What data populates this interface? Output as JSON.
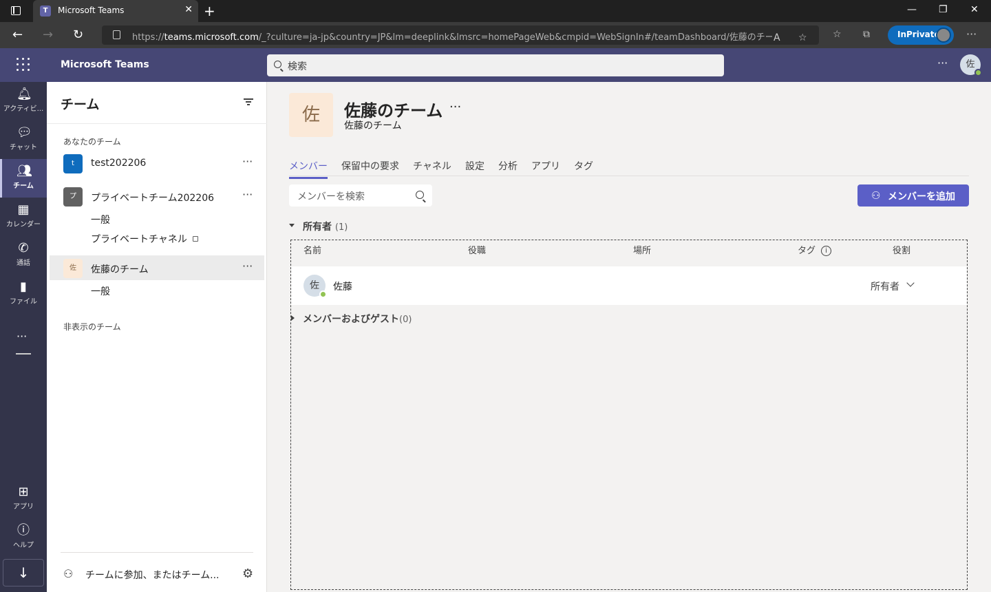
{
  "browser": {
    "tab_title": "Microsoft Teams",
    "url_prefix": "https://",
    "url_host": "teams.microsoft.com",
    "url_rest": "/_?culture=ja-jp&country=JP&lm=deeplink&lmsrc=homePageWeb&cmpid=WebSignIn#/teamDashboard/佐藤のチーム/...",
    "inprivate_label": "InPrivate"
  },
  "header": {
    "brand": "Microsoft Teams",
    "search_placeholder": "検索",
    "user_initial": "佐"
  },
  "rail": {
    "items": [
      {
        "label": "アクティビ...",
        "icon": "bell-icon"
      },
      {
        "label": "チャット",
        "icon": "chat-icon"
      },
      {
        "label": "チーム",
        "icon": "teams-icon"
      },
      {
        "label": "カレンダー",
        "icon": "calendar-icon"
      },
      {
        "label": "通話",
        "icon": "phone-icon"
      },
      {
        "label": "ファイル",
        "icon": "file-icon"
      }
    ],
    "apps_label": "アプリ",
    "help_label": "ヘルプ"
  },
  "panel": {
    "title": "チーム",
    "your_teams_label": "あなたのチーム",
    "teams": [
      {
        "badge": "t",
        "name": "test202206"
      },
      {
        "badge": "プ",
        "name": "プライベートチーム202206",
        "channels": [
          "一般",
          "プライベートチャネル"
        ]
      },
      {
        "badge": "佐",
        "name": "佐藤のチーム",
        "channels": [
          "一般"
        ]
      }
    ],
    "hidden_teams_label": "非表示のチーム",
    "join_label": "チームに参加、またはチーム..."
  },
  "main": {
    "avatar": "佐",
    "title": "佐藤のチーム",
    "subtitle": "佐藤のチーム",
    "tabs": [
      "メンバー",
      "保留中の要求",
      "チャネル",
      "設定",
      "分析",
      "アプリ",
      "タグ"
    ],
    "member_search_placeholder": "メンバーを検索",
    "add_member_label": "メンバーを追加",
    "owners_group": {
      "title": "所有者",
      "count": "(1)"
    },
    "columns": [
      "名前",
      "役職",
      "場所",
      "タグ",
      "役割"
    ],
    "members": [
      {
        "initial": "佐",
        "name": "佐藤",
        "role": "所有者"
      }
    ],
    "members_group": {
      "title": "メンバーおよびゲスト",
      "count": "(0)"
    }
  },
  "colors": {
    "accent": "#5b5fc7",
    "header": "#464775",
    "rail": "#33344a"
  }
}
